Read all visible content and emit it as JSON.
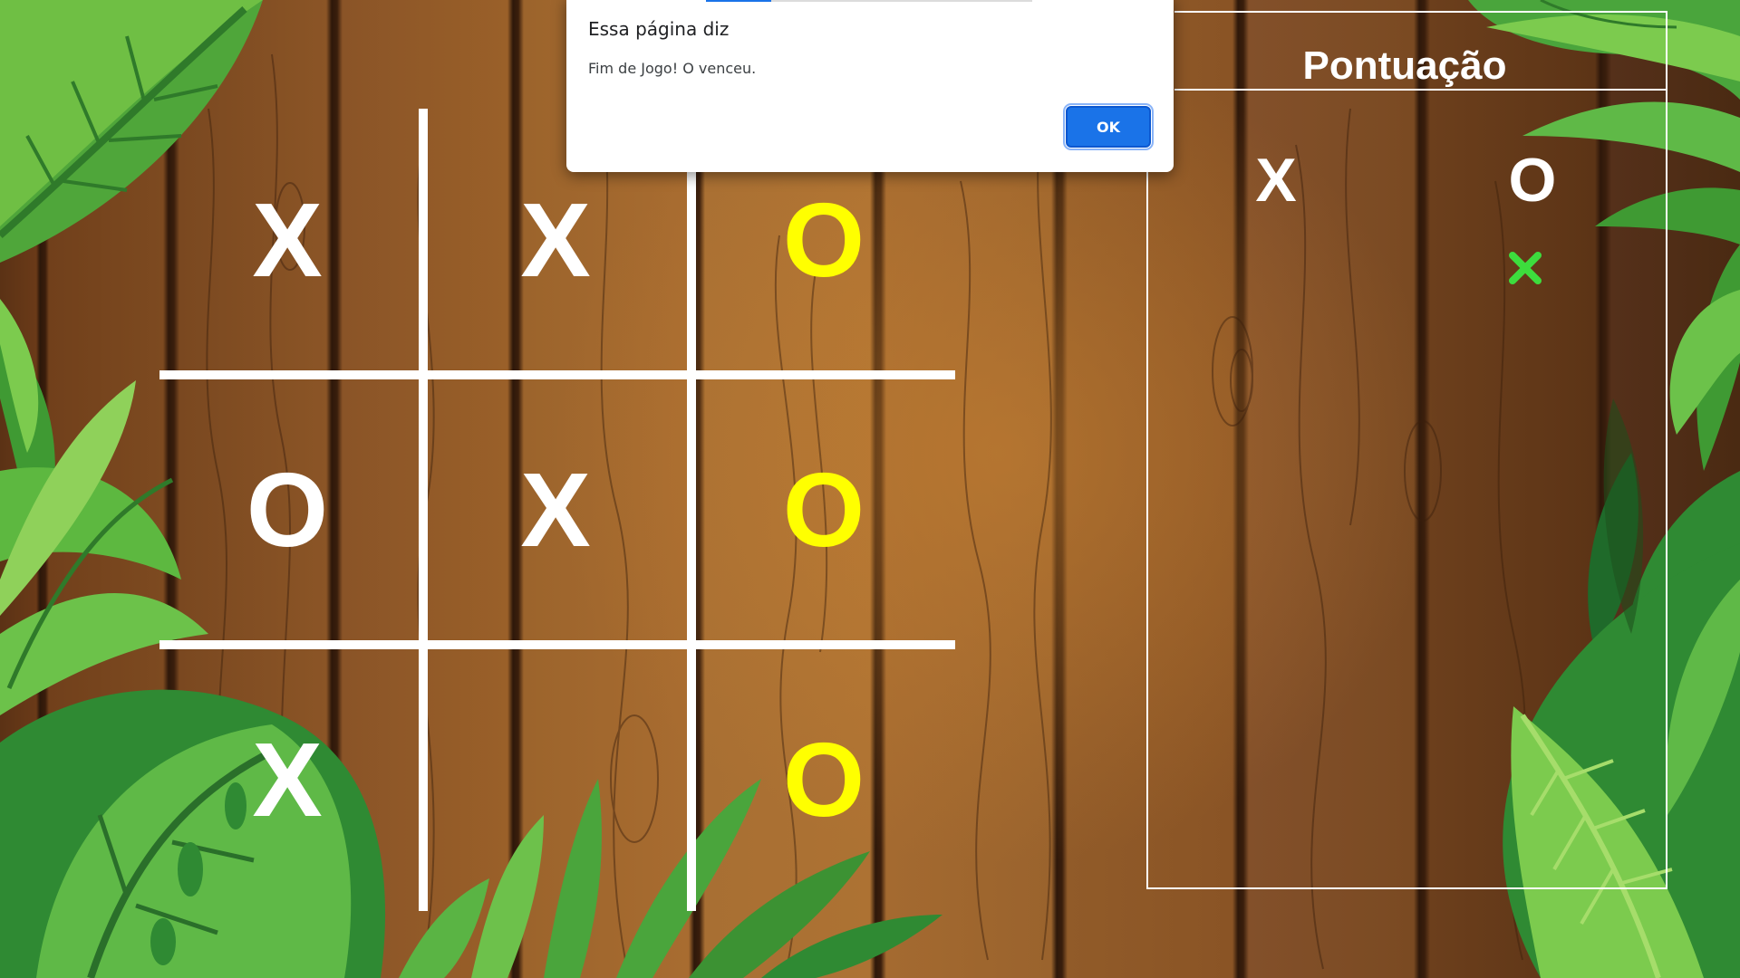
{
  "game": {
    "board": [
      [
        "X",
        "X",
        "O"
      ],
      [
        "O",
        "X",
        "O"
      ],
      [
        "X",
        "",
        "O"
      ]
    ],
    "winning_cells": [
      [
        0,
        2
      ],
      [
        1,
        2
      ],
      [
        2,
        2
      ]
    ],
    "winner_color": "#ffff00",
    "mark_color": "#ffffff"
  },
  "scoreboard": {
    "title": "Pontuação",
    "x_label": "X",
    "o_label": "O",
    "o_points": 1,
    "x_points": 0,
    "point_icon": "green-x-mark",
    "point_color": "#3ddc3d"
  },
  "dialog": {
    "title": "Essa página diz",
    "message": "Fim de Jogo! O venceu.",
    "ok_label": "OK",
    "button_color": "#1a73e8"
  }
}
